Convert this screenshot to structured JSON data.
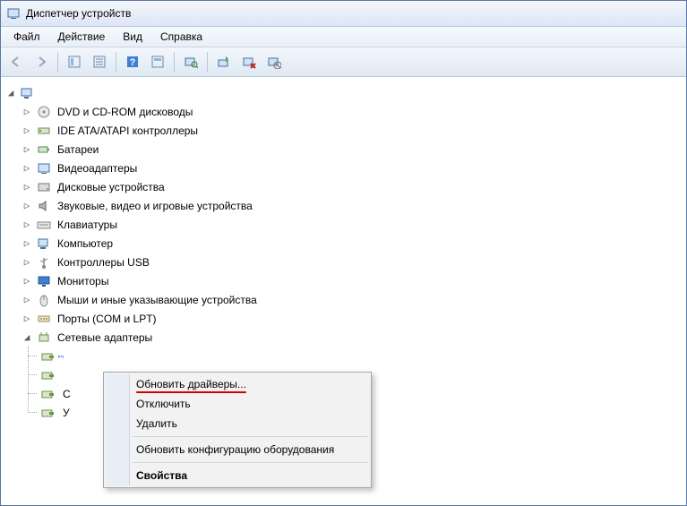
{
  "window": {
    "title": "Диспетчер устройств"
  },
  "menu": {
    "file": "Файл",
    "action": "Действие",
    "view": "Вид",
    "help": "Справка"
  },
  "root": {
    "label": ""
  },
  "categories": [
    {
      "label": "DVD и CD-ROM дисководы",
      "icon": "disc"
    },
    {
      "label": "IDE ATA/ATAPI контроллеры",
      "icon": "ide"
    },
    {
      "label": "Батареи",
      "icon": "battery"
    },
    {
      "label": "Видеоадаптеры",
      "icon": "display"
    },
    {
      "label": "Дисковые устройства",
      "icon": "hdd"
    },
    {
      "label": "Звуковые, видео и игровые устройства",
      "icon": "audio"
    },
    {
      "label": "Клавиатуры",
      "icon": "keyboard"
    },
    {
      "label": "Компьютер",
      "icon": "computer"
    },
    {
      "label": "Контроллеры USB",
      "icon": "usb"
    },
    {
      "label": "Мониторы",
      "icon": "monitor"
    },
    {
      "label": "Мыши и иные указывающие устройства",
      "icon": "mouse"
    },
    {
      "label": "Порты (COM и LPT)",
      "icon": "port"
    },
    {
      "label": "Сетевые адаптеры",
      "icon": "net",
      "expanded": true
    }
  ],
  "net_children": [
    {
      "label": " "
    },
    {
      "label": " "
    },
    {
      "label": " "
    },
    {
      "label": " "
    }
  ],
  "c0_extra": "С",
  "c1_extra": "У",
  "context_menu": {
    "update": "Обновить драйверы...",
    "disable": "Отключить",
    "uninstall": "Удалить",
    "scan": "Обновить конфигурацию оборудования",
    "props": "Свойства"
  }
}
